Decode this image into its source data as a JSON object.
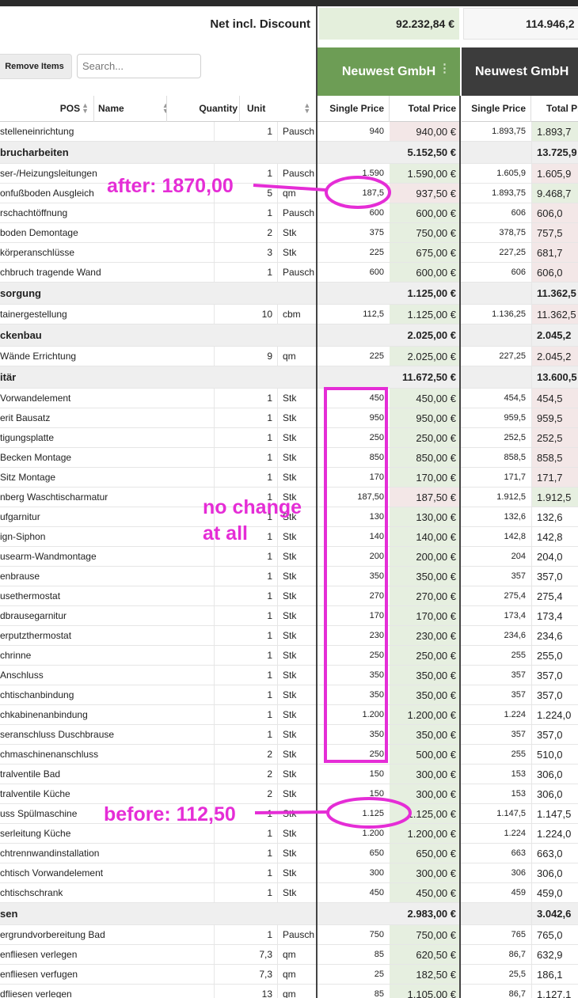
{
  "summary": {
    "label": "Net incl. Discount",
    "vendor1_total": "92.232,84 €",
    "vendor2_total": "114.946,2"
  },
  "toolbar": {
    "remove_label": "Remove Items",
    "search_placeholder": "Search..."
  },
  "vendors": [
    {
      "name": "Neuwest GmbH",
      "menu_icon": "⋮"
    },
    {
      "name": "Neuwest GmbH"
    }
  ],
  "columns": {
    "pos": "POS",
    "name": "Name",
    "quantity": "Quantity",
    "unit": "Unit",
    "single_price": "Single Price",
    "total_price": "Total Price",
    "single_price2": "Single Price",
    "total_price2": "Total Price"
  },
  "colors": {
    "vendor1_header": "#6d9d55",
    "vendor2_header": "#3c3c3c",
    "annotation": "#e52dd6"
  },
  "rows": [
    {
      "type": "item",
      "name": "stelleneinrichtung",
      "qty": "1",
      "unit": "Pausch",
      "sp1": "940",
      "tp1": "940,00 €",
      "tp1_hl": "r",
      "sp2": "1.893,75",
      "tp2": "1.893,7",
      "tp2_hl": "g"
    },
    {
      "type": "section",
      "name": "brucharbeiten",
      "tp1": "5.152,50 €",
      "tp2": "13.725,9"
    },
    {
      "type": "item",
      "name": "ser-/Heizungsleitungen",
      "qty": "1",
      "unit": "Pausch",
      "sp1": "1.590",
      "tp1": "1.590,00 €",
      "tp1_hl": "g",
      "sp2": "1.605,9",
      "tp2": "1.605,9",
      "tp2_hl": "r"
    },
    {
      "type": "item",
      "name": "onfußboden Ausgleich",
      "qty": "5",
      "unit": "qm",
      "sp1": "187,5",
      "tp1": "937,50 €",
      "tp1_hl": "r",
      "sp2": "1.893,75",
      "tp2": "9.468,7",
      "tp2_hl": "g"
    },
    {
      "type": "item",
      "name": "rschachtöffnung",
      "qty": "1",
      "unit": "Pausch",
      "sp1": "600",
      "tp1": "600,00 €",
      "tp1_hl": "g",
      "sp2": "606",
      "tp2": "606,0",
      "tp2_hl": "r"
    },
    {
      "type": "item",
      "name": "boden Demontage",
      "qty": "2",
      "unit": "Stk",
      "sp1": "375",
      "tp1": "750,00 €",
      "tp1_hl": "g",
      "sp2": "378,75",
      "tp2": "757,5",
      "tp2_hl": "r"
    },
    {
      "type": "item",
      "name": "körperanschlüsse",
      "qty": "3",
      "unit": "Stk",
      "sp1": "225",
      "tp1": "675,00 €",
      "tp1_hl": "g",
      "sp2": "227,25",
      "tp2": "681,7",
      "tp2_hl": "r"
    },
    {
      "type": "item",
      "name": "chbruch tragende Wand",
      "qty": "1",
      "unit": "Pausch",
      "sp1": "600",
      "tp1": "600,00 €",
      "tp1_hl": "g",
      "sp2": "606",
      "tp2": "606,0",
      "tp2_hl": "r"
    },
    {
      "type": "section",
      "name": "sorgung",
      "tp1": "1.125,00 €",
      "tp2": "11.362,5"
    },
    {
      "type": "item",
      "name": "tainergestellung",
      "qty": "10",
      "unit": "cbm",
      "sp1": "112,5",
      "tp1": "1.125,00 €",
      "tp1_hl": "g",
      "sp2": "1.136,25",
      "tp2": "11.362,5",
      "tp2_hl": "r"
    },
    {
      "type": "section",
      "name": "ckenbau",
      "tp1": "2.025,00 €",
      "tp2": "2.045,2"
    },
    {
      "type": "item",
      "name": "Wände Errichtung",
      "qty": "9",
      "unit": "qm",
      "sp1": "225",
      "tp1": "2.025,00 €",
      "tp1_hl": "g",
      "sp2": "227,25",
      "tp2": "2.045,2",
      "tp2_hl": "r"
    },
    {
      "type": "section",
      "name": "itär",
      "tp1": "11.672,50 €",
      "tp2": "13.600,5"
    },
    {
      "type": "item",
      "name": "Vorwandelement",
      "qty": "1",
      "unit": "Stk",
      "sp1": "450",
      "tp1": "450,00 €",
      "tp1_hl": "g",
      "sp2": "454,5",
      "tp2": "454,5",
      "tp2_hl": "r"
    },
    {
      "type": "item",
      "name": "erit Bausatz",
      "qty": "1",
      "unit": "Stk",
      "sp1": "950",
      "tp1": "950,00 €",
      "tp1_hl": "g",
      "sp2": "959,5",
      "tp2": "959,5",
      "tp2_hl": "r"
    },
    {
      "type": "item",
      "name": "tigungsplatte",
      "qty": "1",
      "unit": "Stk",
      "sp1": "250",
      "tp1": "250,00 €",
      "tp1_hl": "g",
      "sp2": "252,5",
      "tp2": "252,5",
      "tp2_hl": "r"
    },
    {
      "type": "item",
      "name": "Becken Montage",
      "qty": "1",
      "unit": "Stk",
      "sp1": "850",
      "tp1": "850,00 €",
      "tp1_hl": "g",
      "sp2": "858,5",
      "tp2": "858,5",
      "tp2_hl": "r"
    },
    {
      "type": "item",
      "name": "Sitz Montage",
      "qty": "1",
      "unit": "Stk",
      "sp1": "170",
      "tp1": "170,00 €",
      "tp1_hl": "g",
      "sp2": "171,7",
      "tp2": "171,7",
      "tp2_hl": "r"
    },
    {
      "type": "item",
      "name": "nberg Waschtischarmatur",
      "qty": "1",
      "unit": "Stk",
      "sp1": "187,50",
      "tp1": "187,50 €",
      "tp1_hl": "r",
      "sp2": "1.912,5",
      "tp2": "1.912,5",
      "tp2_hl": "g"
    },
    {
      "type": "item",
      "name": "ufgarnitur",
      "qty": "1",
      "unit": "Stk",
      "sp1": "130",
      "tp1": "130,00 €",
      "tp1_hl": "g",
      "sp2": "132,6",
      "tp2": "132,6",
      "tp2_hl": ""
    },
    {
      "type": "item",
      "name": "ign-Siphon",
      "qty": "1",
      "unit": "Stk",
      "sp1": "140",
      "tp1": "140,00 €",
      "tp1_hl": "g",
      "sp2": "142,8",
      "tp2": "142,8",
      "tp2_hl": ""
    },
    {
      "type": "item",
      "name": "usearm-Wandmontage",
      "qty": "1",
      "unit": "Stk",
      "sp1": "200",
      "tp1": "200,00 €",
      "tp1_hl": "g",
      "sp2": "204",
      "tp2": "204,0",
      "tp2_hl": ""
    },
    {
      "type": "item",
      "name": "enbrause",
      "qty": "1",
      "unit": "Stk",
      "sp1": "350",
      "tp1": "350,00 €",
      "tp1_hl": "g",
      "sp2": "357",
      "tp2": "357,0",
      "tp2_hl": ""
    },
    {
      "type": "item",
      "name": "usethermostat",
      "qty": "1",
      "unit": "Stk",
      "sp1": "270",
      "tp1": "270,00 €",
      "tp1_hl": "g",
      "sp2": "275,4",
      "tp2": "275,4",
      "tp2_hl": ""
    },
    {
      "type": "item",
      "name": "dbrausegarnitur",
      "qty": "1",
      "unit": "Stk",
      "sp1": "170",
      "tp1": "170,00 €",
      "tp1_hl": "g",
      "sp2": "173,4",
      "tp2": "173,4",
      "tp2_hl": ""
    },
    {
      "type": "item",
      "name": "erputzthermostat",
      "qty": "1",
      "unit": "Stk",
      "sp1": "230",
      "tp1": "230,00 €",
      "tp1_hl": "g",
      "sp2": "234,6",
      "tp2": "234,6",
      "tp2_hl": ""
    },
    {
      "type": "item",
      "name": "chrinne",
      "qty": "1",
      "unit": "Stk",
      "sp1": "250",
      "tp1": "250,00 €",
      "tp1_hl": "g",
      "sp2": "255",
      "tp2": "255,0",
      "tp2_hl": ""
    },
    {
      "type": "item",
      "name": "Anschluss",
      "qty": "1",
      "unit": "Stk",
      "sp1": "350",
      "tp1": "350,00 €",
      "tp1_hl": "g",
      "sp2": "357",
      "tp2": "357,0",
      "tp2_hl": ""
    },
    {
      "type": "item",
      "name": "chtischanbindung",
      "qty": "1",
      "unit": "Stk",
      "sp1": "350",
      "tp1": "350,00 €",
      "tp1_hl": "g",
      "sp2": "357",
      "tp2": "357,0",
      "tp2_hl": ""
    },
    {
      "type": "item",
      "name": "chkabinenanbindung",
      "qty": "1",
      "unit": "Stk",
      "sp1": "1.200",
      "tp1": "1.200,00 €",
      "tp1_hl": "g",
      "sp2": "1.224",
      "tp2": "1.224,0",
      "tp2_hl": ""
    },
    {
      "type": "item",
      "name": "seranschluss Duschbrause",
      "qty": "1",
      "unit": "Stk",
      "sp1": "350",
      "tp1": "350,00 €",
      "tp1_hl": "g",
      "sp2": "357",
      "tp2": "357,0",
      "tp2_hl": ""
    },
    {
      "type": "item",
      "name": "chmaschinenanschluss",
      "qty": "2",
      "unit": "Stk",
      "sp1": "250",
      "tp1": "500,00 €",
      "tp1_hl": "g",
      "sp2": "255",
      "tp2": "510,0",
      "tp2_hl": ""
    },
    {
      "type": "item",
      "name": "tralventile Bad",
      "qty": "2",
      "unit": "Stk",
      "sp1": "150",
      "tp1": "300,00 €",
      "tp1_hl": "g",
      "sp2": "153",
      "tp2": "306,0",
      "tp2_hl": ""
    },
    {
      "type": "item",
      "name": "tralventile Küche",
      "qty": "2",
      "unit": "Stk",
      "sp1": "150",
      "tp1": "300,00 €",
      "tp1_hl": "g",
      "sp2": "153",
      "tp2": "306,0",
      "tp2_hl": ""
    },
    {
      "type": "item",
      "name": "uss Spülmaschine",
      "qty": "1",
      "unit": "Stk",
      "sp1": "1.125",
      "tp1": "1.125,00 €",
      "tp1_hl": "g",
      "sp2": "1.147,5",
      "tp2": "1.147,5",
      "tp2_hl": ""
    },
    {
      "type": "item",
      "name": "serleitung Küche",
      "qty": "1",
      "unit": "Stk",
      "sp1": "1.200",
      "tp1": "1.200,00 €",
      "tp1_hl": "g",
      "sp2": "1.224",
      "tp2": "1.224,0",
      "tp2_hl": ""
    },
    {
      "type": "item",
      "name": "chtrennwandinstallation",
      "qty": "1",
      "unit": "Stk",
      "sp1": "650",
      "tp1": "650,00 €",
      "tp1_hl": "g",
      "sp2": "663",
      "tp2": "663,0",
      "tp2_hl": ""
    },
    {
      "type": "item",
      "name": "chtisch Vorwandelement",
      "qty": "1",
      "unit": "Stk",
      "sp1": "300",
      "tp1": "300,00 €",
      "tp1_hl": "g",
      "sp2": "306",
      "tp2": "306,0",
      "tp2_hl": ""
    },
    {
      "type": "item",
      "name": "chtischschrank",
      "qty": "1",
      "unit": "Stk",
      "sp1": "450",
      "tp1": "450,00 €",
      "tp1_hl": "g",
      "sp2": "459",
      "tp2": "459,0",
      "tp2_hl": ""
    },
    {
      "type": "section",
      "name": "sen",
      "tp1": "2.983,00 €",
      "tp2": "3.042,6"
    },
    {
      "type": "item",
      "name": "ergrundvorbereitung Bad",
      "qty": "1",
      "unit": "Pausch",
      "sp1": "750",
      "tp1": "750,00 €",
      "tp1_hl": "g",
      "sp2": "765",
      "tp2": "765,0",
      "tp2_hl": ""
    },
    {
      "type": "item",
      "name": "enfliesen verlegen",
      "qty": "7,3",
      "unit": "qm",
      "sp1": "85",
      "tp1": "620,50 €",
      "tp1_hl": "g",
      "sp2": "86,7",
      "tp2": "632,9",
      "tp2_hl": ""
    },
    {
      "type": "item",
      "name": "enfliesen verfugen",
      "qty": "7,3",
      "unit": "qm",
      "sp1": "25",
      "tp1": "182,50 €",
      "tp1_hl": "g",
      "sp2": "25,5",
      "tp2": "186,1",
      "tp2_hl": ""
    },
    {
      "type": "item",
      "name": "dfliesen verlegen",
      "qty": "13",
      "unit": "qm",
      "sp1": "85",
      "tp1": "1.105,00 €",
      "tp1_hl": "g",
      "sp2": "86,7",
      "tp2": "1.127,1",
      "tp2_hl": ""
    }
  ],
  "annotations": {
    "after": "after: 1870,00",
    "no_change_1": "no change",
    "no_change_2": "at all",
    "before": "before: 112,50"
  }
}
